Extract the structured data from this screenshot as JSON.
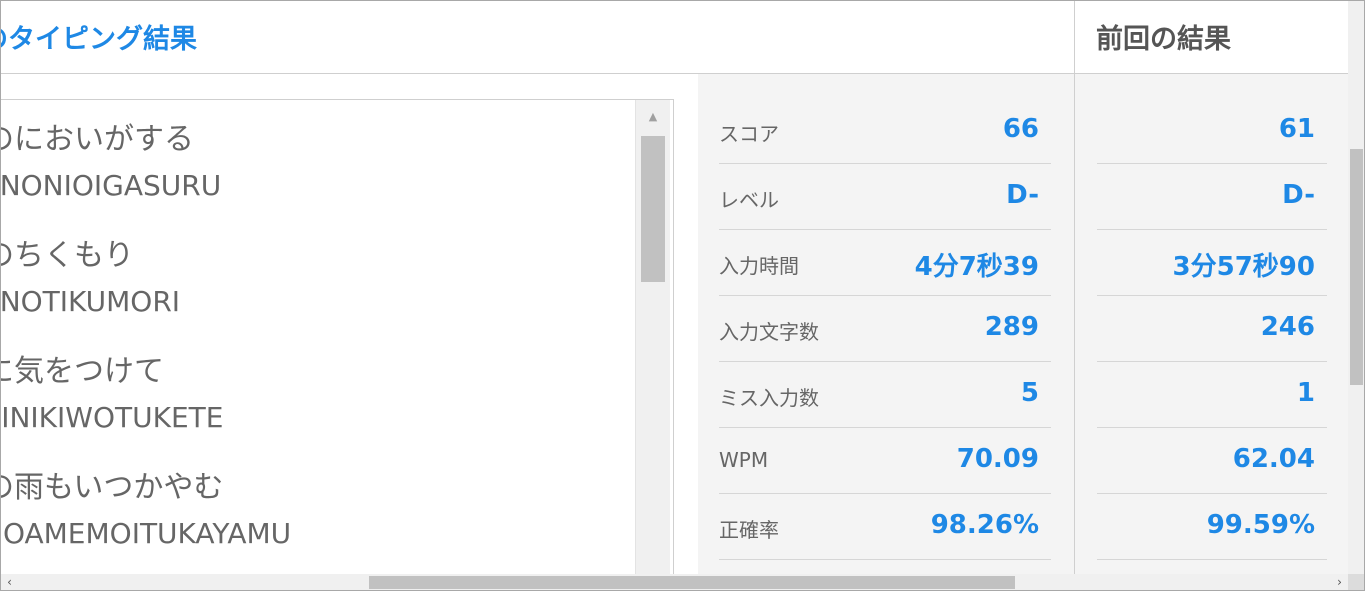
{
  "header": {
    "title": "のタイピング結果",
    "previous_title": "前回の結果"
  },
  "words": [
    {
      "jp": "のにおいがする",
      "romaji": "ENONIOIGASURU"
    },
    {
      "jp": "のちくもり",
      "romaji": "ENOTIKUMORI"
    },
    {
      "jp": "に気をつけて",
      "romaji": "BINIKIWOTUKETE"
    },
    {
      "jp": "の雨もいつかやむ",
      "romaji": "NOAMEMOITUKAYAMU"
    }
  ],
  "stats": {
    "score": {
      "label": "スコア",
      "value": "66"
    },
    "level": {
      "label": "レベル",
      "value": "D-"
    },
    "time": {
      "label": "入力時間",
      "value": "4分7秒39"
    },
    "chars": {
      "label": "入力文字数",
      "value": "289"
    },
    "misses": {
      "label": "ミス入力数",
      "value": "5"
    },
    "wpm": {
      "label": "WPM",
      "value": "70.09"
    },
    "accuracy": {
      "label": "正確率",
      "value": "98.26%"
    }
  },
  "previous": {
    "score": "61",
    "level": "D-",
    "time": "3分57秒90",
    "chars": "246",
    "misses": "1",
    "wpm": "62.04",
    "accuracy": "99.59%"
  },
  "icons": {
    "scroll_up": "triangle-up",
    "scroll_left": "chevron-left",
    "scroll_right": "chevron-right"
  },
  "colors": {
    "accent": "#1e88e5",
    "panel_bg": "#f4f4f4",
    "text": "#555555"
  }
}
